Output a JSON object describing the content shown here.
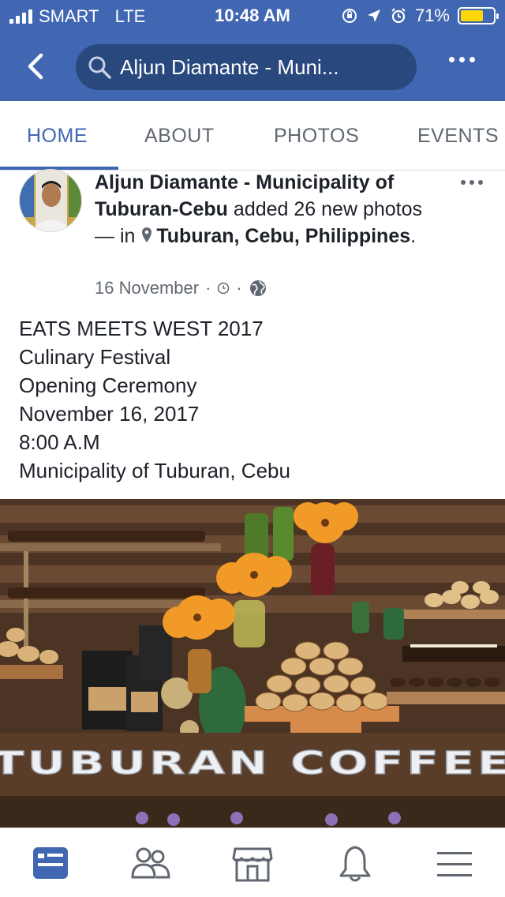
{
  "status_bar": {
    "carrier": "SMART",
    "network": "LTE",
    "time": "10:48 AM",
    "battery": "71%",
    "battery_level": 0.71
  },
  "nav": {
    "search_text": "Aljun Diamante - Muni...",
    "icons": [
      "back-chevron-icon",
      "search-icon",
      "more-options-icon"
    ]
  },
  "tabs": [
    "HOME",
    "ABOUT",
    "PHOTOS",
    "EVENTS"
  ],
  "active_tab": "HOME",
  "post": {
    "author": "Aljun Diamante - Municipality of Tuburan-Cebu",
    "action": " added 26 new photos — in ",
    "location": "Tuburan, Cebu, Philippines",
    "location_suffix": ".",
    "date": "16 November",
    "separator": "·",
    "body": [
      "EATS MEETS WEST 2017",
      "Culinary Festival",
      "Opening Ceremony",
      "November 16, 2017",
      "8:00 A.M",
      "Municipality of Tuburan, Cebu"
    ],
    "photo_sign": "TUBURAN COFFEE"
  },
  "bottom_nav": [
    "news-feed-icon",
    "friends-icon",
    "marketplace-icon",
    "notifications-icon",
    "menu-icon"
  ],
  "colors": {
    "brand": "#4267b2",
    "search_pill": "#29487d",
    "text": "#1d2129",
    "muted": "#606770"
  }
}
